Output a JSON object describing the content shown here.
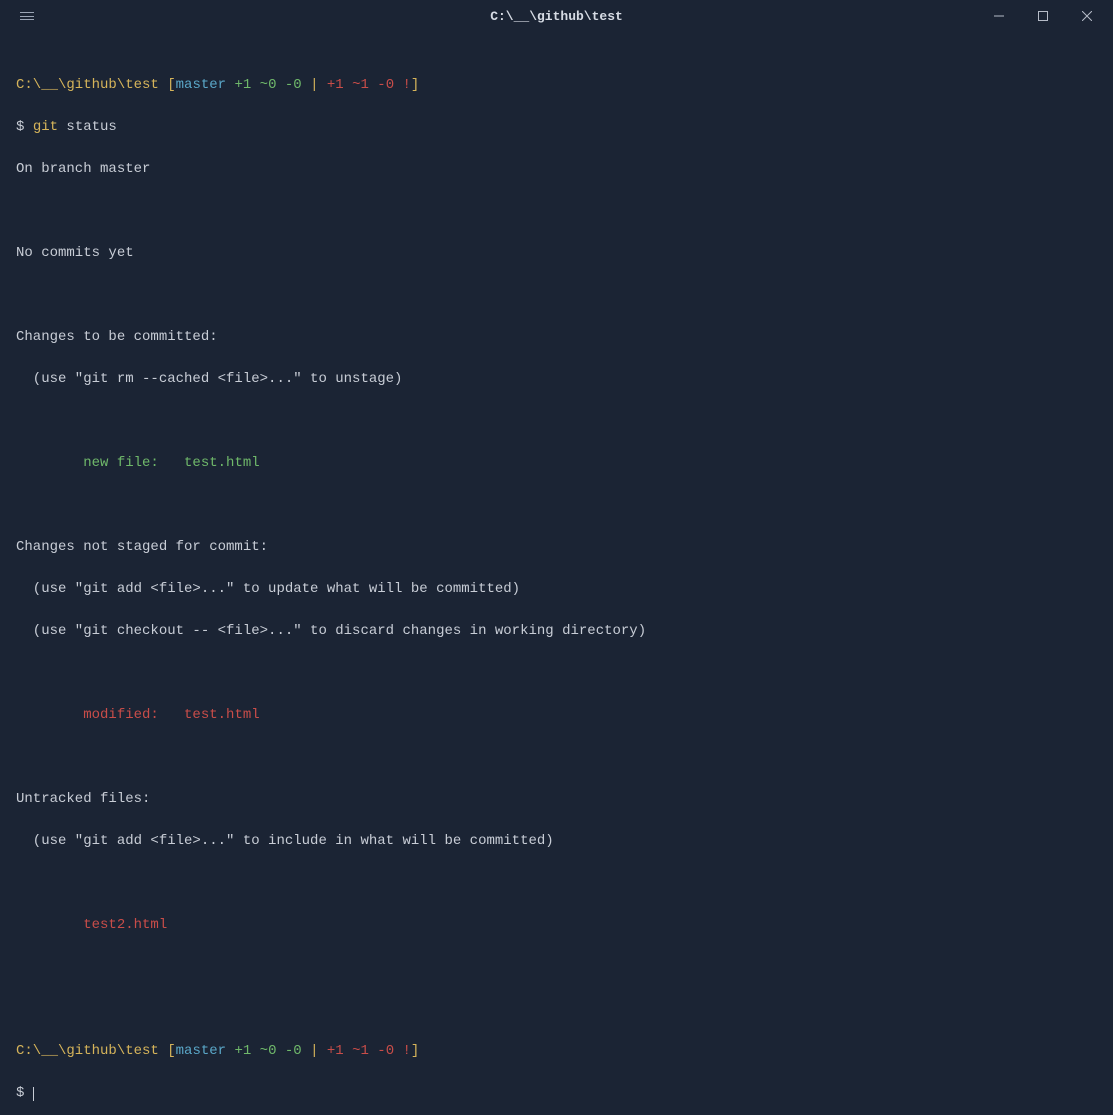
{
  "window": {
    "title": "C:\\__\\github\\test"
  },
  "prompt1": {
    "path": "C:\\__\\github\\test",
    "open": " [",
    "branch": "master",
    "staged": " +1 ~0 -0 ",
    "sep": "|",
    "unstaged": " +1 ~1 -0 !",
    "close": "]"
  },
  "cmd": {
    "sym": "$ ",
    "git": "git ",
    "status": "status"
  },
  "out": {
    "branch": "On branch master",
    "blank": "",
    "nocommits": "No commits yet",
    "changes_committed": "Changes to be committed:",
    "use_rm": "  (use \"git rm --cached <file>...\" to unstage)",
    "newfile_label": "        new file:   ",
    "newfile_name": "test.html",
    "changes_notstaged": "Changes not staged for commit:",
    "use_add_update": "  (use \"git add <file>...\" to update what will be committed)",
    "use_checkout": "  (use \"git checkout -- <file>...\" to discard changes in working directory)",
    "modified_label": "        modified:   ",
    "modified_name": "test.html",
    "untracked": "Untracked files:",
    "use_add_include": "  (use \"git add <file>...\" to include in what will be committed)",
    "untracked_name": "        test2.html"
  },
  "prompt2": {
    "sym": "$ "
  }
}
